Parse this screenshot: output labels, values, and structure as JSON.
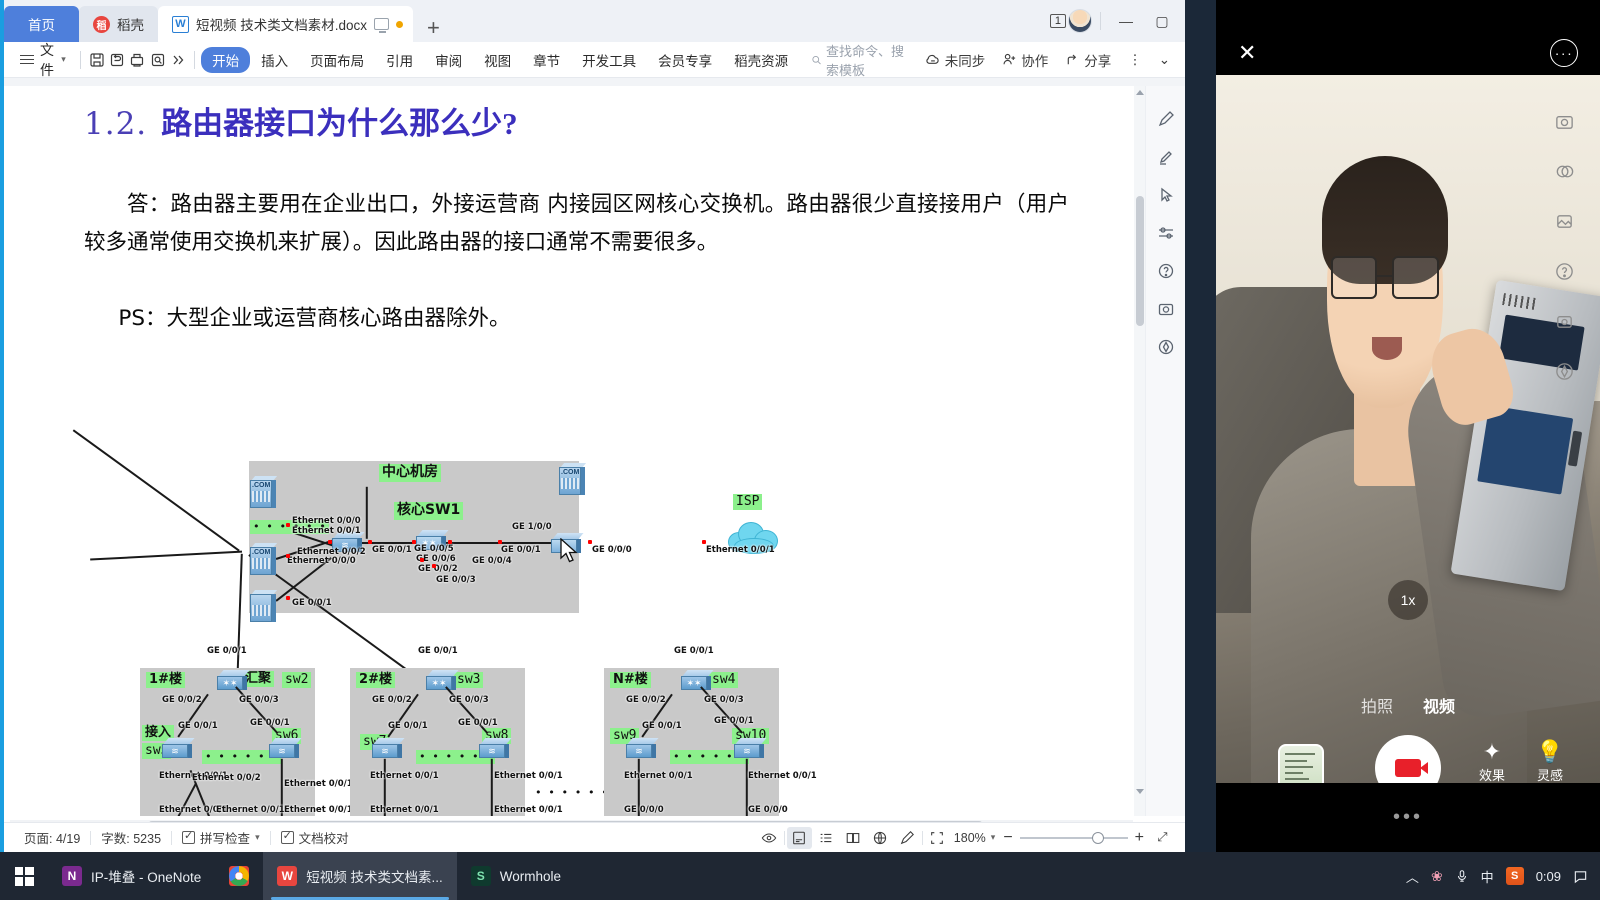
{
  "window": {
    "tabs": [
      {
        "label": "首页",
        "type": "home"
      },
      {
        "label": "稻壳",
        "type": "plain"
      },
      {
        "label": "短视频 技术类文档素材.docx",
        "type": "active"
      }
    ],
    "new_tab_label": "+",
    "page_count_badge": "1",
    "controls": {
      "minimize": "—",
      "maximize": "▢",
      "close": "✕"
    }
  },
  "ribbon": {
    "file_label": "文件",
    "quick_icons": [
      "save-icon",
      "undo-icon",
      "print-icon",
      "print-preview-icon",
      "more-icon"
    ],
    "tabs": [
      {
        "label": "开始",
        "selected": true
      },
      {
        "label": "插入",
        "selected": false
      },
      {
        "label": "页面布局",
        "selected": false
      },
      {
        "label": "引用",
        "selected": false
      },
      {
        "label": "审阅",
        "selected": false
      },
      {
        "label": "视图",
        "selected": false
      },
      {
        "label": "章节",
        "selected": false
      },
      {
        "label": "开发工具",
        "selected": false
      },
      {
        "label": "会员专享",
        "selected": false
      },
      {
        "label": "稻壳资源",
        "selected": false
      }
    ],
    "search_placeholder": "查找命令、搜索模板",
    "actions": [
      {
        "label": "未同步",
        "icon": "cloud-off-icon"
      },
      {
        "label": "协作",
        "icon": "collaborate-icon"
      },
      {
        "label": "分享",
        "icon": "share-icon"
      }
    ],
    "overflow": "⋮",
    "collapse": "⌄"
  },
  "document": {
    "heading_number": "1.2.",
    "heading_text": "路由器接口为什么那么少?",
    "paragraph_1": "答：路由器主要用在企业出口，外接运营商 内接园区网核心交换机。路由器很少直接接用户（用户较多通常使用交换机来扩展）。因此路由器的接口通常不需要很多。",
    "paragraph_2": "PS：大型企业或运营商核心路由器除外。"
  },
  "diagram": {
    "zones": [
      {
        "name": "中心机房"
      },
      {
        "name": "1#楼"
      },
      {
        "name": "2#楼"
      },
      {
        "name": "N#楼"
      }
    ],
    "device_labels": [
      {
        "name": "核心SW1"
      },
      {
        "name": "ISP"
      },
      {
        "name": "汇聚"
      },
      {
        "name": "sw2"
      },
      {
        "name": "sw3"
      },
      {
        "name": "sw4"
      },
      {
        "name": "接入"
      },
      {
        "name": "sw5"
      },
      {
        "name": "sw6"
      },
      {
        "name": "sw7"
      },
      {
        "name": "sw8"
      },
      {
        "name": "sw9"
      },
      {
        "name": "sw10"
      }
    ],
    "interface_labels": [
      "Ethernet 0/0/0",
      "Ethernet 0/0/1",
      "Ethernet 0/0/2",
      "Ethernet 0/0/0",
      "GE 0/0/1",
      "GE 0/0/5",
      "GE 0/0/6",
      "GE 0/0/2",
      "GE 0/0/3",
      "GE 0/0/4",
      "GE 0/0/1",
      "GE 1/0/0",
      "GE 0/0/0",
      "Ethernet 0/0/1",
      "GE 0/0/1"
    ],
    "dots": "• • • • • •"
  },
  "status_bar": {
    "page": "页面: 4/19",
    "words": "字数: 5235",
    "spellcheck": "拼写检查",
    "proofread": "文档校对",
    "zoom_level": "180%",
    "view_buttons": [
      "eye-icon",
      "page-view-icon",
      "outline-view-icon",
      "book-view-icon",
      "web-view-icon",
      "edit-mode-icon",
      "fit-icon"
    ],
    "zoom_out": "−",
    "zoom_in": "+",
    "fullscreen": "⤢"
  },
  "camera": {
    "close_label": "✕",
    "more_label": "···",
    "zoom": "1x",
    "modes": [
      {
        "label": "拍照",
        "active": false
      },
      {
        "label": "视频",
        "active": true
      }
    ],
    "tools": [
      {
        "label": "效果",
        "icon": "sparkle-icon"
      },
      {
        "label": "灵感",
        "icon": "lightbulb-icon"
      }
    ],
    "shutter": "record-button",
    "gallery": "gallery-thumbnail",
    "bottom_dots": "•••"
  },
  "taskbar": {
    "start": "start-button",
    "items": [
      {
        "label": "IP-堆叠 - OneNote",
        "icon": "onenote",
        "active": false
      },
      {
        "label": "",
        "icon": "chrome",
        "active": false
      },
      {
        "label": "短视频 技术类文档素...",
        "icon": "wps",
        "active": true
      },
      {
        "label": "Wormhole",
        "icon": "wormhole",
        "active": false
      }
    ],
    "tray": {
      "chevron": "︿",
      "icons": [
        "flower-icon",
        "microphone-icon"
      ],
      "ime": "中",
      "sogou": "S",
      "clock": "0:09",
      "notifications": "notification-icon"
    }
  },
  "colors": {
    "accent_blue": "#4e7fdb",
    "heading_purple": "#3b2fbd",
    "diagram_green": "#8cf08c",
    "diagram_gray": "#c9c9c9",
    "taskbar": "#1f2733",
    "record_red": "#e8202a"
  }
}
